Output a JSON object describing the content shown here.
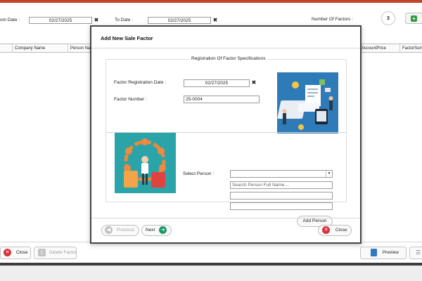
{
  "filters": {
    "from_date_label": "om Date :",
    "from_date_value": "02/27/2025",
    "to_date_label": "To Date :",
    "to_date_value": "02/27/2025",
    "number_of_factors_label": "Number Of Factors :",
    "number_of_factors_value": "3"
  },
  "grid": {
    "columns": [
      "Company Name",
      "Person Na",
      "",
      "DiscountPrice",
      "FactorSum"
    ]
  },
  "bottom_toolbar": {
    "close_label": "Close",
    "delete_factor_label": "Delete Factor",
    "preview_label": "Preview"
  },
  "modal": {
    "title": "Add New Sale Factor",
    "group_title": "Registration Of Factor Specifications",
    "factor_registration_date_label": "Factor Registration Date :",
    "factor_registration_date_value": "02/27/2025",
    "factor_number_label": "Factor Number :",
    "factor_number_value": "25-0004",
    "select_person_label": "Select Person :",
    "select_person_value": "",
    "search_person_placeholder": "Search Person Full Name....",
    "add_person_label": "Add Person",
    "previous_label": "Previous",
    "next_label": "Next",
    "close_label": "Close"
  },
  "colors": {
    "accent_bar": "#c1442a",
    "close_icon": "#d8323a",
    "next_icon": "#1b9a64",
    "add_icon": "#2e9b3f"
  }
}
